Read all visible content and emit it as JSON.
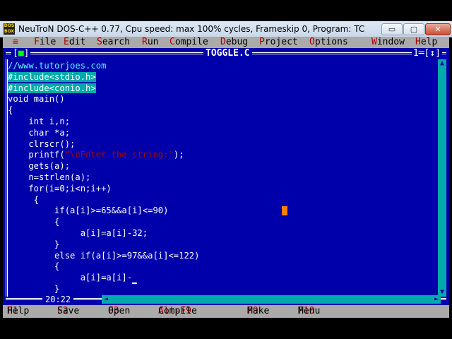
{
  "window": {
    "icon_text": "DOS BOX",
    "title": "NeuTroN DOS-C++ 0.77, Cpu speed: max 100% cycles, Frameskip  0, Program:    TC",
    "buttons": {
      "minimize": "▭",
      "maximize": "▢",
      "close": "✕"
    }
  },
  "menu": {
    "system": "≡",
    "items": [
      {
        "hot": "F",
        "rest": "ile"
      },
      {
        "hot": "E",
        "rest": "dit"
      },
      {
        "hot": "S",
        "rest": "earch"
      },
      {
        "hot": "R",
        "rest": "un"
      },
      {
        "hot": "C",
        "rest": "ompile"
      },
      {
        "hot": "D",
        "rest": "ebug"
      },
      {
        "hot": "P",
        "rest": "roject"
      },
      {
        "hot": "O",
        "rest": "ptions"
      },
      {
        "hot": "W",
        "rest": "indow"
      },
      {
        "hot": "H",
        "rest": "elp"
      }
    ]
  },
  "editor": {
    "close_box_open": "[",
    "close_box_mark": "■",
    "close_box_close": "]",
    "filename": "TOGGLE.C",
    "window_number": "1",
    "zoom_arrow": "↕",
    "cursor_position": "20:22",
    "code": [
      {
        "segments": [
          {
            "t": "//www.tutorjoes.com",
            "c": "cmt"
          }
        ]
      },
      {
        "segments": [
          {
            "t": "#include<stdio.h>",
            "c": "hl"
          }
        ]
      },
      {
        "segments": [
          {
            "t": "#include<conio.h>",
            "c": "hl"
          }
        ]
      },
      {
        "segments": [
          {
            "t": "void main()",
            "c": ""
          }
        ]
      },
      {
        "segments": [
          {
            "t": "{",
            "c": ""
          }
        ]
      },
      {
        "segments": [
          {
            "t": "    int i,n;",
            "c": ""
          }
        ]
      },
      {
        "segments": [
          {
            "t": "    char *a;",
            "c": ""
          }
        ]
      },
      {
        "segments": [
          {
            "t": "    clrscr();",
            "c": ""
          }
        ]
      },
      {
        "segments": [
          {
            "t": "    printf(",
            "c": ""
          },
          {
            "t": "\"\\nEnter the string:\"",
            "c": "str"
          },
          {
            "t": ");",
            "c": ""
          }
        ]
      },
      {
        "segments": [
          {
            "t": "    gets(a);",
            "c": ""
          }
        ]
      },
      {
        "segments": [
          {
            "t": "    n=strlen(a);",
            "c": ""
          }
        ]
      },
      {
        "segments": [
          {
            "t": "    for(i=0;i<n;i++)",
            "c": ""
          }
        ]
      },
      {
        "segments": [
          {
            "t": "     {",
            "c": ""
          }
        ]
      },
      {
        "segments": [
          {
            "t": "         if(a[i]>=65&&a[i]<=90)",
            "c": ""
          }
        ]
      },
      {
        "segments": [
          {
            "t": "         {",
            "c": ""
          }
        ]
      },
      {
        "segments": [
          {
            "t": "              a[i]=a[i]-32;",
            "c": ""
          }
        ]
      },
      {
        "segments": [
          {
            "t": "         }",
            "c": ""
          }
        ]
      },
      {
        "segments": [
          {
            "t": "         else if(a[i]>=97&&a[i]<=122)",
            "c": ""
          }
        ]
      },
      {
        "segments": [
          {
            "t": "         {",
            "c": ""
          }
        ]
      },
      {
        "segments": [
          {
            "t": "              a[i]=a[i]-",
            "c": ""
          },
          {
            "t": " ",
            "c": "cursor"
          }
        ]
      },
      {
        "segments": [
          {
            "t": "         }",
            "c": ""
          }
        ]
      }
    ]
  },
  "status": {
    "items": [
      {
        "key": "F1",
        "label": " Help"
      },
      {
        "key": "F2",
        "label": " Save"
      },
      {
        "key": "F3",
        "label": " Open"
      },
      {
        "key": "Alt-F9",
        "label": " Compile"
      },
      {
        "key": "F9",
        "label": " Make"
      },
      {
        "key": "F10",
        "label": " Menu"
      }
    ]
  },
  "scroll_arrows": {
    "up": "▲",
    "down": "▼",
    "left": "◄",
    "right": "►"
  },
  "colors": {
    "editor_bg": "#0000aa",
    "menu_bg": "#aaaaaa",
    "hotkey": "#aa0000",
    "highlight": "#00aaaa",
    "comment": "#55ffff"
  }
}
